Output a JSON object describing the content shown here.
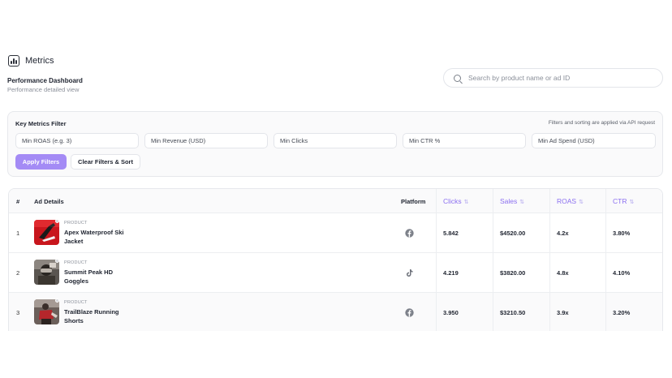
{
  "header": {
    "title": "Metrics",
    "icon": "bar-chart-icon"
  },
  "dashboard": {
    "title": "Performance Dashboard",
    "subtitle": "Performance detailed view"
  },
  "search": {
    "placeholder": "Search by product name or ad ID",
    "icon": "search-icon"
  },
  "filters": {
    "title": "Key Metrics Filter",
    "note": "Filters and sorting are applied via API request",
    "inputs": [
      {
        "placeholder": "Min ROAS (e.g. 3)"
      },
      {
        "placeholder": "Min Revenue (USD)"
      },
      {
        "placeholder": "Min Clicks"
      },
      {
        "placeholder": "Min CTR %"
      },
      {
        "placeholder": "Min Ad Spend (USD)"
      }
    ],
    "apply_label": "Apply Filters",
    "clear_label": "Clear Filters & Sort"
  },
  "colors": {
    "accent": "#a48bf5",
    "sort_header": "#8b6ff0"
  },
  "table": {
    "headers": {
      "index": "#",
      "ad_details": "Ad Details",
      "platform": "Platform",
      "clicks": "Clicks",
      "sales": "Sales",
      "roas": "ROAS",
      "ctr": "CTR",
      "sort_icon": "sort-icon"
    },
    "rows": [
      {
        "index": "1",
        "tag": "PRODUCT",
        "name": "Apex Waterproof Ski Jacket",
        "platform": "facebook-icon",
        "clicks": "5.842",
        "sales": "$4520.00",
        "roas": "4.2x",
        "ctr": "3.80%"
      },
      {
        "index": "2",
        "tag": "PRODUCT",
        "name": "Summit Peak HD Goggles",
        "platform": "tiktok-icon",
        "clicks": "4.219",
        "sales": "$3820.00",
        "roas": "4.8x",
        "ctr": "4.10%"
      },
      {
        "index": "3",
        "tag": "PRODUCT",
        "name": "TrailBlaze Running Shorts",
        "platform": "facebook-icon",
        "clicks": "3.950",
        "sales": "$3210.50",
        "roas": "3.9x",
        "ctr": "3.20%"
      }
    ]
  }
}
